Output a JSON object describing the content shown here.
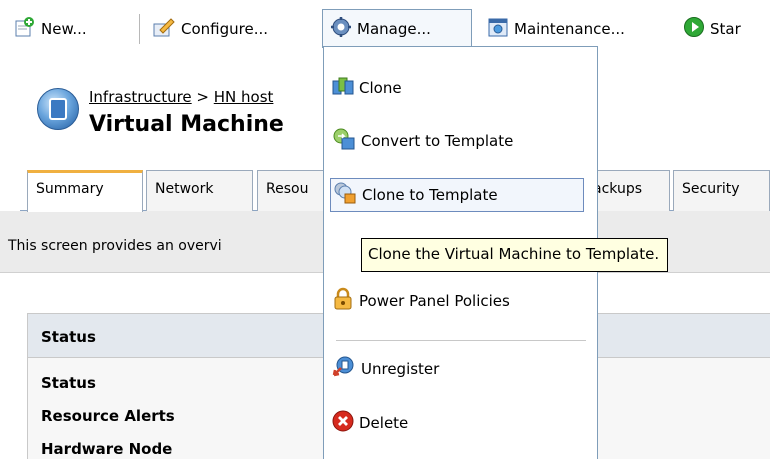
{
  "toolbar": {
    "new_label": "New...",
    "configure_label": "Configure...",
    "manage_label": "Manage...",
    "maintenance_label": "Maintenance...",
    "start_label": "Star"
  },
  "header": {
    "breadcrumb_root": "Infrastructure",
    "breadcrumb_sep": " > ",
    "breadcrumb_child": "HN host",
    "title": "Virtual Machine"
  },
  "tabs": [
    {
      "label": "Summary"
    },
    {
      "label": "Network"
    },
    {
      "label": "Resou"
    },
    {
      "label": "ackups"
    },
    {
      "label": "Security"
    }
  ],
  "intro_text": "This screen provides an overvi",
  "status": {
    "heading": "Status",
    "rows": [
      "Status",
      "Resource Alerts",
      "Hardware Node"
    ]
  },
  "manage_menu": {
    "items": [
      {
        "label": "Clone",
        "icon": "clone-icon"
      },
      {
        "label": "Convert to Template",
        "icon": "convert-template-icon"
      },
      {
        "label": "Clone to Template",
        "icon": "clone-template-icon"
      },
      {
        "label": "Power Panel Policies",
        "icon": "lock-icon"
      },
      {
        "label": "Unregister",
        "icon": "unregister-icon"
      },
      {
        "label": "Delete",
        "icon": "delete-icon"
      }
    ]
  },
  "tooltip": "Clone the Virtual Machine to Template.",
  "colors": {
    "menu_border": "#7f9db9",
    "hover_border": "#6d8bbd",
    "tooltip_bg": "#ffffe1",
    "active_tab_accent": "#f0b040"
  }
}
